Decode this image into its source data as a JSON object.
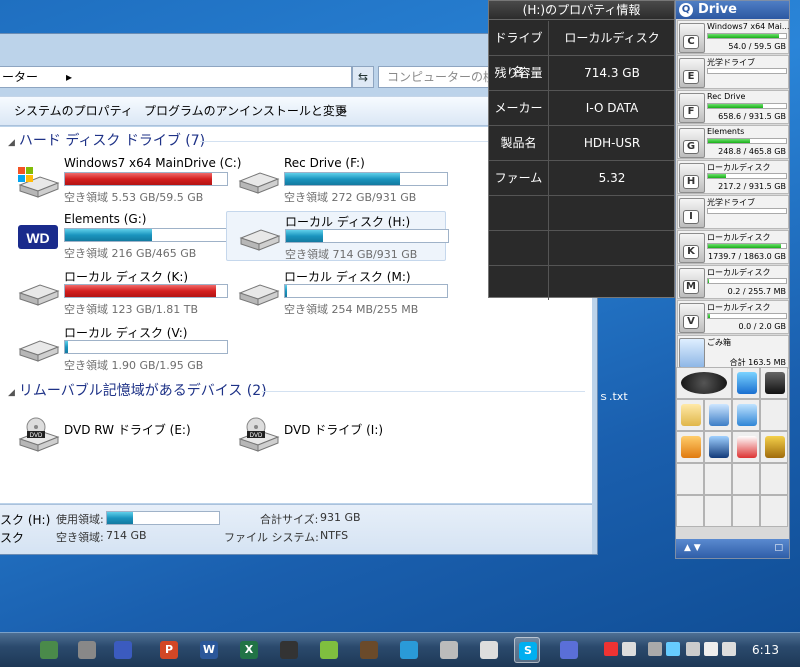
{
  "explorer": {
    "address_text": "ーター",
    "address_sep": "▸",
    "refresh_icon": "refresh-icon",
    "search_placeholder": "コンピューターの検索",
    "toolbar": {
      "system_properties": "システムのプロパティ",
      "uninstall": "プログラムのアンインストールと変更",
      "more": "»"
    },
    "hdd_group": "ハード ディスク ドライブ (7)",
    "removable_group": "リムーバブル記憶域があるデバイス (2)",
    "drives": [
      {
        "name": "Windows7 x64 MainDrive (C:)",
        "free": "空き領域 5.53 GB/59.5 GB",
        "used_fraction": 0.91,
        "color": "#d41f1f"
      },
      {
        "name": "Rec Drive (F:)",
        "free": "空き領域 272 GB/931 GB",
        "used_fraction": 0.71,
        "color": "#1b95bf"
      },
      {
        "name": "Elements (G:)",
        "free": "空き領域 216 GB/465 GB",
        "used_fraction": 0.54,
        "color": "#1b95bf"
      },
      {
        "name": "ローカル ディスク (H:)",
        "free": "空き領域 714 GB/931 GB",
        "used_fraction": 0.23,
        "color": "#1b95bf"
      },
      {
        "name": "ローカル ディスク (K:)",
        "free": "空き領域 123 GB/1.81 TB",
        "used_fraction": 0.93,
        "color": "#d41f1f"
      },
      {
        "name": "ローカル ディスク (M:)",
        "free": "空き領域 254 MB/255 MB",
        "used_fraction": 0.01,
        "color": "#1b95bf"
      },
      {
        "name": "ローカル ディスク (V:)",
        "free": "空き領域 1.90 GB/1.95 GB",
        "used_fraction": 0.02,
        "color": "#1b95bf"
      }
    ],
    "removable": [
      {
        "name": "DVD RW ドライブ (E:)"
      },
      {
        "name": "DVD ドライブ (I:)"
      }
    ],
    "details": {
      "drive_name": "スク (H:)",
      "drive_sub": "スク",
      "used_label": "使用領域:",
      "free_label": "空き領域:",
      "free_value": "714 GB",
      "total_label": "合計サイズ:",
      "total_value": "931 GB",
      "fs_label": "ファイル システム:",
      "fs_value": "NTFS",
      "used_fraction": 0.23
    }
  },
  "desktop_file": "ｓ.txt",
  "property_popup": {
    "title": "(H:)のプロパティ情報",
    "rows": [
      {
        "label": "ドライブ名",
        "value": "ローカルディスク"
      },
      {
        "label": "残り容量",
        "value": "714.3 GB"
      },
      {
        "label": "メーカー",
        "value": "I-O DATA"
      },
      {
        "label": "製品名",
        "value": "HDH-USR"
      },
      {
        "label": "ファーム",
        "value": "5.32"
      },
      {
        "label": "",
        "value": ""
      },
      {
        "label": "",
        "value": ""
      },
      {
        "label": "",
        "value": ""
      }
    ]
  },
  "drive_center": {
    "title": "Drive Center",
    "drives": [
      {
        "letter": "C",
        "name": "Windows7 x64 Mai...",
        "size": "54.0 / 59.5 GB",
        "fraction": 0.91
      },
      {
        "letter": "E",
        "name": "光学ドライブ",
        "size": "",
        "fraction": 0
      },
      {
        "letter": "F",
        "name": "Rec Drive",
        "size": "658.6 / 931.5 GB",
        "fraction": 0.71
      },
      {
        "letter": "G",
        "name": "Elements",
        "size": "248.8 / 465.8 GB",
        "fraction": 0.54
      },
      {
        "letter": "H",
        "name": "ローカルディスク",
        "size": "217.2 / 931.5 GB",
        "fraction": 0.23
      },
      {
        "letter": "I",
        "name": "光学ドライブ",
        "size": "",
        "fraction": 0
      },
      {
        "letter": "K",
        "name": "ローカルディスク",
        "size": "1739.7 / 1863.0 GB",
        "fraction": 0.93
      },
      {
        "letter": "M",
        "name": "ローカルディスク",
        "size": "0.2 / 255.7 MB",
        "fraction": 0.01
      },
      {
        "letter": "V",
        "name": "ローカルディスク",
        "size": "0.0 / 2.0 GB",
        "fraction": 0.02
      }
    ],
    "trash_label": "ごみ箱",
    "trash_size": "合計 163.5 MB",
    "bottom_arrows": "▲ ▼",
    "bottom_square": "□"
  },
  "taskbar": {
    "clock": "6:13"
  }
}
